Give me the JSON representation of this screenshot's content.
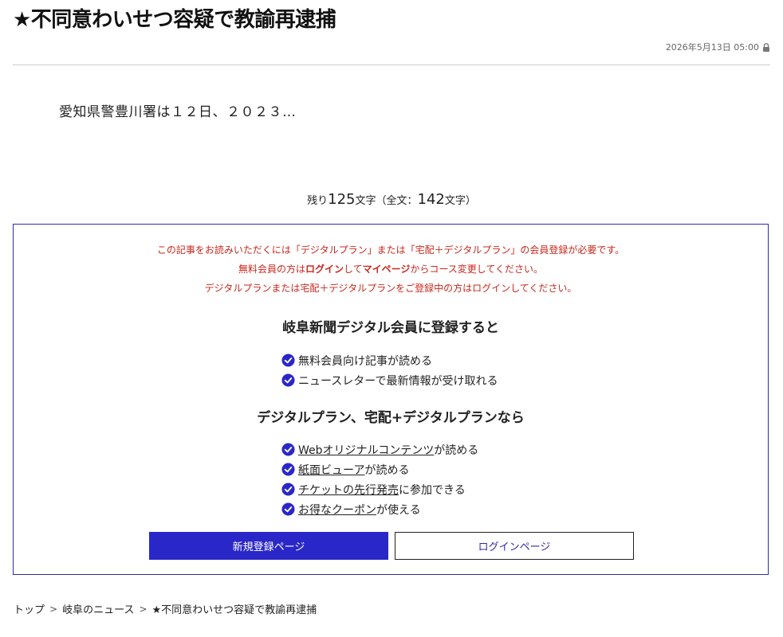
{
  "article": {
    "title": "★不同意わいせつ容疑で教諭再逮捕",
    "date": "2026年5月13日 05:00",
    "lead": "愛知県警豊川署は１２日、２０２３…"
  },
  "remaining": {
    "prefix": "残り",
    "remaining_count": "125",
    "mid": "文字（全文：",
    "total_count": "142",
    "suffix": "文字）"
  },
  "paywall": {
    "notice_line1": "この記事をお読みいただくには「デジタルプラン」または「宅配＋デジタルプラン」の会員登録が必要です。",
    "notice_line2_a": "無料会員の方は",
    "notice_line2_login": "ログイン",
    "notice_line2_b": "して",
    "notice_line2_mypage": "マイページ",
    "notice_line2_c": "からコース変更してください。",
    "notice_line3": "デジタルプランまたは宅配＋デジタルプランをご登録中の方はログインしてください。",
    "free_title": "岐阜新聞デジタル会員に登録すると",
    "free_benefits": [
      {
        "text": "無料会員向け記事が読める"
      },
      {
        "text": "ニュースレターで最新情報が受け取れる"
      }
    ],
    "paid_title": "デジタルプラン、宅配+デジタルプランなら",
    "paid_benefits": [
      {
        "link": "Webオリジナルコンテンツ",
        "rest": "が読める"
      },
      {
        "link": "紙面ビューア",
        "rest": "が読める"
      },
      {
        "link": "チケットの先行発売",
        "rest": "に参加できる"
      },
      {
        "link": "お得なクーポン",
        "rest": "が使える"
      }
    ],
    "register_button": "新規登録ページ",
    "login_button": "ログインページ"
  },
  "breadcrumb": {
    "top": "トップ",
    "sep": ">",
    "section": "岐阜のニュース",
    "current": "★不同意わいせつ容疑で教諭再逮捕"
  },
  "colors": {
    "accent": "#2a27c9",
    "notice": "#c8281e"
  }
}
